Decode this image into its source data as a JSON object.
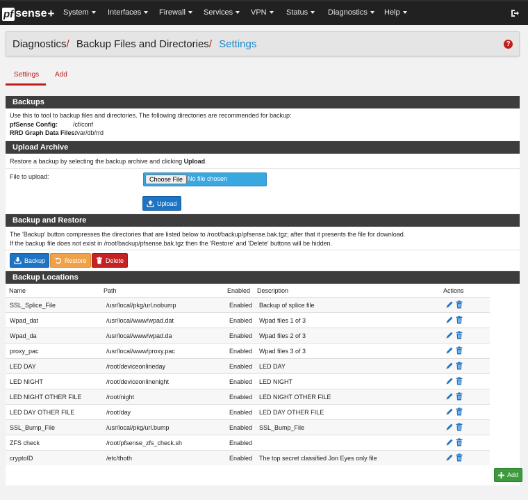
{
  "brand": {
    "name_pf": "pf",
    "name_sense": "sense",
    "plus": "+"
  },
  "nav": {
    "items": [
      "System",
      "Interfaces",
      "Firewall",
      "Services",
      "VPN",
      "Status",
      "Diagnostics",
      "Help"
    ]
  },
  "breadcrumb": {
    "part1": "Diagnostics",
    "part2": "Backup Files and Directories",
    "current": "Settings",
    "sep": "/"
  },
  "tabs": {
    "settings": "Settings",
    "add": "Add"
  },
  "backups": {
    "title": "Backups",
    "intro": "Use this to tool to backup files and directories. The following directories are recommended for backup:",
    "config_label": "pfSense Config:",
    "config_path": "/cf/conf",
    "rrd_label": "RRD Graph Data Files:",
    "rrd_path": "/var/db/rrd"
  },
  "upload": {
    "title": "Upload Archive",
    "desc_prefix": "Restore a backup by selecting the backup archive and clicking ",
    "desc_bold": "Upload",
    "desc_suffix": ".",
    "file_label": "File to upload:",
    "choose_button": "Choose File",
    "file_status": "No file chosen",
    "upload_button": "Upload"
  },
  "backup_restore": {
    "title": "Backup and Restore",
    "line1": "The 'Backup' button compresses the directories that are listed below to /root/backup/pfsense.bak.tgz; after that it presents the file for download.",
    "line2": "If the backup file does not exist in /root/backup/pfsense.bak.tgz then the 'Restore' and 'Delete' buttons will be hidden.",
    "backup_button": "Backup",
    "restore_button": "Restore",
    "delete_button": "Delete"
  },
  "locations": {
    "title": "Backup Locations",
    "columns": {
      "name": "Name",
      "path": "Path",
      "enabled": "Enabled",
      "description": "Description",
      "actions": "Actions"
    },
    "rows": [
      {
        "name": "SSL_Splice_File",
        "path": "/usr/local/pkg/url.nobump",
        "enabled": "Enabled",
        "description": "Backup of splice file"
      },
      {
        "name": "Wpad_dat",
        "path": "/usr/local/www/wpad.dat",
        "enabled": "Enabled",
        "description": "Wpad files 1 of 3"
      },
      {
        "name": "Wpad_da",
        "path": "/usr/local/www/wpad.da",
        "enabled": "Enabled",
        "description": "Wpad files 2 of 3"
      },
      {
        "name": "proxy_pac",
        "path": "/usr/local/www/proxy.pac",
        "enabled": "Enabled",
        "description": "Wpad files 3 of 3"
      },
      {
        "name": "LED DAY",
        "path": "/root/deviceonlineday",
        "enabled": "Enabled",
        "description": "LED DAY"
      },
      {
        "name": "LED NIGHT",
        "path": "/root/deviceonlinenight",
        "enabled": "Enabled",
        "description": "LED NIGHT"
      },
      {
        "name": "LED NIGHT OTHER FILE",
        "path": "/root/night",
        "enabled": "Enabled",
        "description": "LED NIGHT OTHER FILE"
      },
      {
        "name": "LED DAY OTHER FILE",
        "path": "/root/day",
        "enabled": "Enabled",
        "description": "LED DAY OTHER FILE"
      },
      {
        "name": "SSL_Bump_File",
        "path": "/usr/local/pkg/url.bump",
        "enabled": "Enabled",
        "description": "SSL_Bump_File"
      },
      {
        "name": "ZFS check",
        "path": "/root/pfsense_zfs_check.sh",
        "enabled": "Enabled",
        "description": ""
      },
      {
        "name": "cryptoID",
        "path": "/etc/thoth",
        "enabled": "Enabled",
        "description": "The top secret classified Jon Eyes only file"
      }
    ],
    "add_button": "Add"
  },
  "colors": {
    "accent_red": "#c21c1c",
    "link_blue": "#1e88c9",
    "navbar": "#212121",
    "panel_head": "#3d3d3d"
  }
}
